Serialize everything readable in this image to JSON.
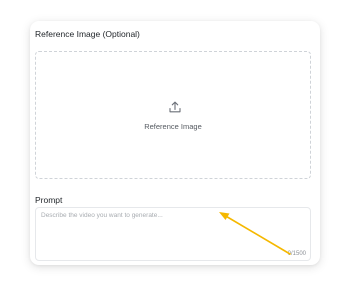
{
  "reference_image": {
    "title": "Reference Image (Optional)",
    "dropzone_label": "Reference Image",
    "icon": "upload-icon"
  },
  "prompt": {
    "title": "Prompt",
    "placeholder": "Describe the video you want to generate...",
    "value": "",
    "char_count": "0/1500"
  },
  "annotation": {
    "arrow_color": "#f5b800"
  }
}
